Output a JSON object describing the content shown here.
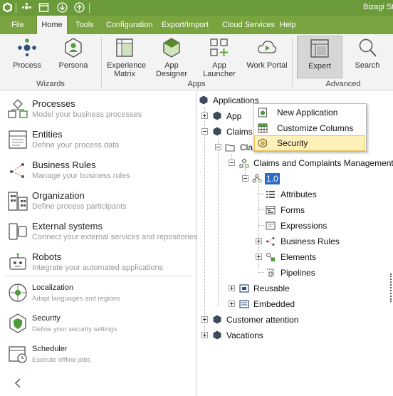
{
  "app": {
    "title": "Bizagi St"
  },
  "quick_access": [
    "bizagi-logo-icon",
    "sync-icon",
    "window-icon",
    "download-icon",
    "upload-icon"
  ],
  "menu": {
    "items": [
      "File",
      "Home",
      "Tools",
      "Configuration",
      "Export/Import",
      "Cloud Services",
      "Help"
    ],
    "active": "Home"
  },
  "ribbon": {
    "buttons": {
      "process": "Process",
      "persona": "Persona",
      "experience_1": "Experience",
      "experience_2": "Matrix",
      "app_designer": "App Designer",
      "app_launcher": "App Launcher",
      "work_portal": "Work Portal",
      "expert": "Expert",
      "search": "Search"
    },
    "groups": {
      "wizards": "Wizards",
      "apps": "Apps",
      "advanced": "Advanced"
    },
    "selected": "Expert"
  },
  "left_panel": {
    "items": [
      {
        "title": "Processes",
        "desc": "Model your business processes",
        "icon": "processes-icon"
      },
      {
        "title": "Entities",
        "desc": "Define your process data",
        "icon": "entities-icon"
      },
      {
        "title": "Business Rules",
        "desc": "Manage your business rules",
        "icon": "business-rules-icon"
      },
      {
        "title": "Organization",
        "desc": "Define process participants",
        "icon": "organization-icon"
      },
      {
        "title": "External systems",
        "desc": "Connect your external services and repositories",
        "icon": "external-systems-icon"
      },
      {
        "title": "Robots",
        "desc": "Integrate your automated applications",
        "icon": "robots-icon"
      },
      {
        "title": "Localization",
        "desc": "Adapt languages and regions",
        "icon": "localization-icon"
      },
      {
        "title": "Security",
        "desc": "Define your security settings",
        "icon": "security-icon"
      },
      {
        "title": "Scheduler",
        "desc": "Execute offline jobs",
        "icon": "scheduler-icon"
      }
    ],
    "collapse_icon": "chevron-left-icon"
  },
  "tree": {
    "applications": "Applications",
    "app": "App",
    "claims": "Claims",
    "claims_folder": "Cla",
    "process": "Claims and Complaints Management",
    "version": "1.0",
    "attributes": "Attributes",
    "forms": "Forms",
    "expressions": "Expressions",
    "business_rules": "Business Rules",
    "elements": "Elements",
    "pipelines": "Pipelines",
    "reusable": "Reusable",
    "embedded": "Embedded",
    "customer_attention": "Customer attention",
    "vacations": "Vacations"
  },
  "context_menu": {
    "items": [
      {
        "label": "New Application",
        "icon": "new-application-icon"
      },
      {
        "label": "Customize Columns",
        "icon": "customize-columns-icon"
      },
      {
        "label": "Security",
        "icon": "security-shield-icon"
      }
    ],
    "highlighted": "Security"
  },
  "colors": {
    "title_bar": "#6b9a3a",
    "menu_bar": "#7aa43f",
    "accent_green": "#5a8a2a",
    "selection_blue": "#2a6cc4",
    "highlight": "#fdf0b8"
  }
}
